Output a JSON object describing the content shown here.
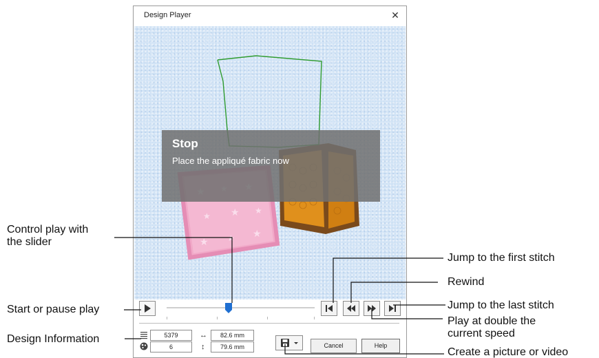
{
  "dialog": {
    "title": "Design Player",
    "close_glyph": "✕"
  },
  "overlay": {
    "title": "Stop",
    "message": "Place the appliqué fabric now"
  },
  "design_info": {
    "stitches": "5379",
    "colors": "6",
    "width": "82.6 mm",
    "height": "79.6 mm",
    "stitch_icon": "stitch-count-icon",
    "color_icon": "color-count-icon",
    "width_glyph": "↔",
    "height_glyph": "↕"
  },
  "buttons": {
    "cancel": "Cancel",
    "help": "Help"
  },
  "slider": {
    "position_fraction": 0.42
  },
  "callouts": {
    "control_play_line1": "Control play with",
    "control_play_line2": "the slider",
    "start_pause": "Start or pause play",
    "design_info": "Design Information",
    "jump_first": "Jump to the first stitch",
    "rewind": "Rewind",
    "jump_last": "Jump to the last stitch",
    "double_speed_line1": "Play at double the",
    "double_speed_line2": "current speed",
    "create_picture": "Create a picture or video"
  },
  "colors": {
    "canvas_bg": "#cfe2f5",
    "slider_thumb": "#1f6fd1",
    "outline_green": "#2e9b2e",
    "pink_block": "#f1a9c8",
    "orange_block": "#e0901c"
  }
}
